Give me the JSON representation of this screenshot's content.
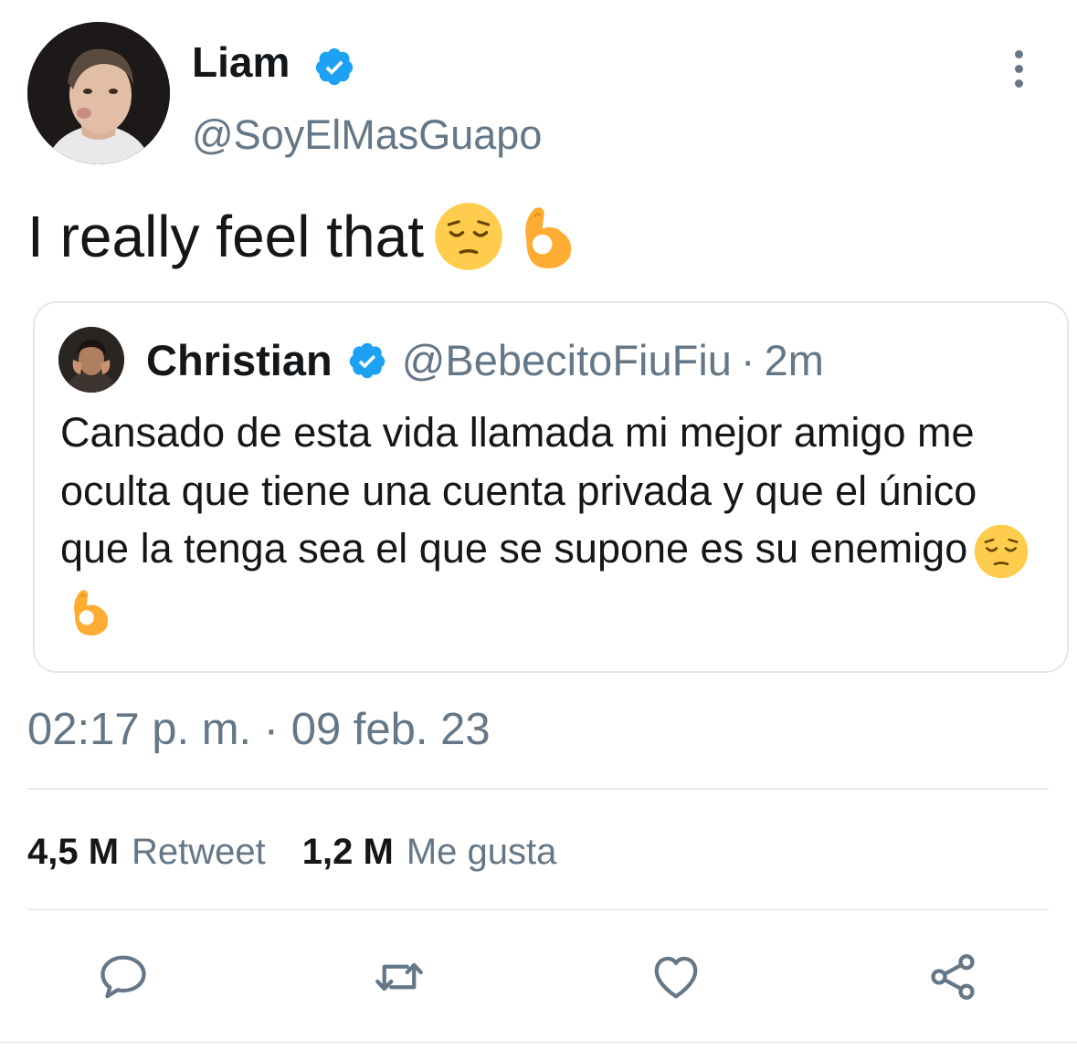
{
  "author": {
    "name": "Liam",
    "handle": "@SoyElMasGuapo",
    "verified_icon": "verified-badge-icon",
    "avatar": "profile-photo"
  },
  "tweet": {
    "text": "I really feel that",
    "emojis": [
      "pensive-face-emoji",
      "ok-hand-emoji"
    ]
  },
  "quoted_tweet": {
    "name": "Christian",
    "handle": "@BebecitoFiuFiu",
    "separator": "·",
    "time": "2m",
    "text": "Cansado de esta vida llamada mi mejor amigo me oculta que tiene una cuenta privada y que el único que la tenga sea el que se supone es su enemigo",
    "emojis": [
      "pensive-face-emoji",
      "ok-hand-emoji"
    ]
  },
  "timestamp": "02:17 p. m. · 09 feb. 23",
  "stats": {
    "retweets_count": "4,5 M",
    "retweets_label": "Retweet",
    "likes_count": "1,2 M",
    "likes_label": "Me gusta"
  },
  "actions": [
    "reply-icon",
    "retweet-icon",
    "like-icon",
    "share-icon"
  ],
  "colors": {
    "text_primary": "#14171a",
    "text_secondary": "#657786",
    "verified_blue": "#1da1f2",
    "divider": "#e6ecf0",
    "border": "#e1e8ed",
    "emoji_yellow": "#ffcc4d"
  }
}
